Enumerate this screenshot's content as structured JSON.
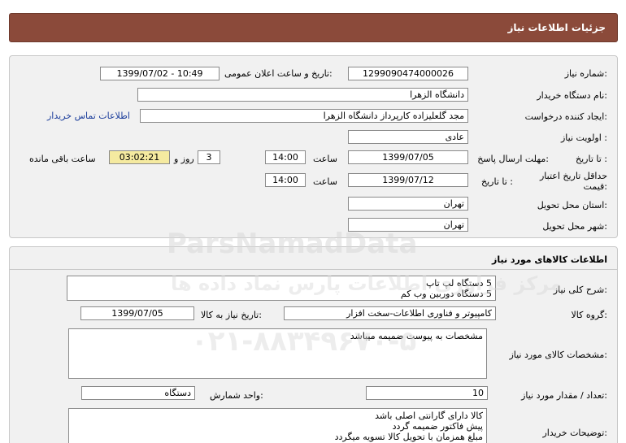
{
  "header": {
    "title": "جزئیات اطلاعات نیاز"
  },
  "need": {
    "number_label": "شماره نیاز:",
    "number": "1299090474000026",
    "announce_label": "تاریخ و ساعت اعلان عمومی:",
    "announce_value": "1399/07/02 - 10:49",
    "buyer_label": "نام دستگاه خریدار:",
    "buyer": "دانشگاه الزهرا",
    "creator_label": "ایجاد کننده درخواست:",
    "creator": "مجد گلعلیزاده کارپرداز دانشگاه الزهرا",
    "contact_link": "اطلاعات تماس خریدار",
    "priority_label": "اولویت نیاز :",
    "priority": "عادی",
    "deadline_label": "مهلت ارسال پاسخ:",
    "to_date_label": "تا تاریخ :",
    "deadline_date": "1399/07/05",
    "time_label": "ساعت",
    "deadline_time": "14:00",
    "days_value": "3",
    "days_label": "روز و",
    "remaining_time": "03:02:21",
    "remaining_label": "ساعت باقی مانده",
    "validity_label": "حداقل تاریخ اعتبار قیمت:",
    "validity_date": "1399/07/12",
    "validity_time": "14:00",
    "province_label": "استان محل تحویل:",
    "province": "تهران",
    "city_label": "شهر محل تحویل:",
    "city": "تهران"
  },
  "goods": {
    "section_title": "اطلاعات کالاهای مورد نیاز",
    "summary_label": "شرح کلی نیاز:",
    "summary_lines": [
      "5 دستگاه لپ تاپ",
      "5 دستگاه دوربین وب کم"
    ],
    "group_label": "گروه کالا:",
    "group": "کامپیوتر و فناوری اطلاعات-سخت افزار",
    "need_date_label": "تاریخ نیاز به کالا:",
    "need_date": "1399/07/05",
    "specs_label": "مشخصات کالای مورد نیاز:",
    "specs": "مشخصات به پیوست ضمیمه میباشد",
    "qty_label": "تعداد / مقدار مورد نیاز:",
    "qty": "10",
    "unit_label": "واحد شمارش:",
    "unit": "دستگاه",
    "notes_label": "توضیحات خریدار:",
    "notes_lines": [
      "کالا دارای گارانتی اصلی باشد",
      "پیش فاکتور ضمیمه گردد",
      "مبلغ همزمان با تحویل کالا تسویه میگردد"
    ]
  },
  "watermark": {
    "brand": "ParsNamadData",
    "persian": "مرکز فراوری اطلاعات پارس نماد داده ها",
    "phone": "۰۲۱-۸۸۳۴۹۶۷۰-۵"
  },
  "colors": {
    "header_bg": "#8b4a3a",
    "panel_bg": "#f1f1f1",
    "link": "#1b3d9b",
    "remaining_bg": "#f5eaa0"
  }
}
